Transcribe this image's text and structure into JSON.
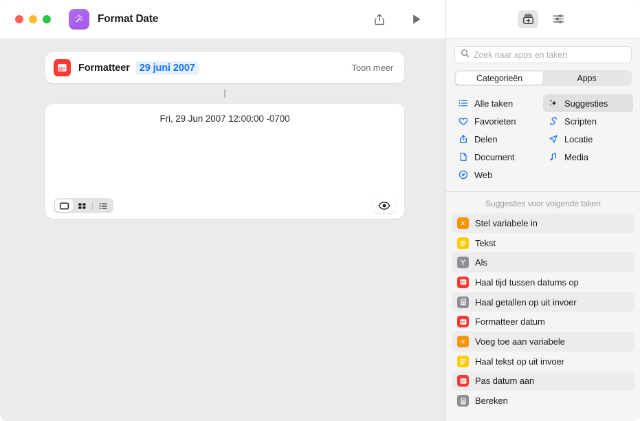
{
  "window": {
    "title": "Format Date",
    "app_icon": "magic-wand-icon",
    "traffic_lights": [
      "close",
      "minimize",
      "zoom"
    ],
    "toolbar": [
      {
        "name": "share-icon",
        "label": "Deel"
      },
      {
        "name": "play-icon",
        "label": "Voer uit"
      }
    ]
  },
  "editor": {
    "action": {
      "icon": "calendar-icon",
      "icon_color": "#fa3b33",
      "label": "Formatteer",
      "token": "29 juni 2007",
      "token_color": "#1573f5",
      "show_more": "Toon meer"
    },
    "result": {
      "text": "Fri, 29 Jun 2007 12:00:00 -0700"
    },
    "view_modes": [
      {
        "name": "single-view-icon",
        "active": true
      },
      {
        "name": "grid-view-icon",
        "active": false
      },
      {
        "name": "list-view-icon",
        "active": false
      }
    ],
    "preview_toggle": {
      "name": "eye-icon"
    }
  },
  "library": {
    "toolbar": [
      {
        "name": "action-library-icon",
        "selected": true
      },
      {
        "name": "sliders-icon",
        "selected": false
      }
    ],
    "search": {
      "placeholder": "Zoek naar apps en taken",
      "value": "",
      "icon": "search-icon"
    },
    "tabs": [
      {
        "label": "Categorieën",
        "active": true
      },
      {
        "label": "Apps",
        "active": false
      }
    ],
    "categories": [
      {
        "label": "Alle taken",
        "icon": "list-bullet-icon",
        "selected": false
      },
      {
        "label": "Suggesties",
        "icon": "sparkles-icon",
        "selected": true
      },
      {
        "label": "Favorieten",
        "icon": "heart-icon",
        "selected": false
      },
      {
        "label": "Scripten",
        "icon": "script-icon",
        "selected": false
      },
      {
        "label": "Delen",
        "icon": "share-icon",
        "selected": false
      },
      {
        "label": "Locatie",
        "icon": "location-icon",
        "selected": false
      },
      {
        "label": "Document",
        "icon": "document-icon",
        "selected": false
      },
      {
        "label": "Media",
        "icon": "music-note-icon",
        "selected": false
      },
      {
        "label": "Web",
        "icon": "compass-icon",
        "selected": false
      }
    ],
    "suggestions_header": "Suggesties voor volgende taken",
    "suggestions": [
      {
        "label": "Stel variabele in",
        "icon": "variable-icon",
        "color": "#f89406",
        "glyph": "x",
        "stripe": true
      },
      {
        "label": "Tekst",
        "icon": "text-icon",
        "color": "#ffcc00",
        "glyph": "≡",
        "stripe": false
      },
      {
        "label": "Als",
        "icon": "if-icon",
        "color": "#8e8e93",
        "glyph": "Y",
        "stripe": true
      },
      {
        "label": "Haal tijd tussen datums op",
        "icon": "calendar-icon",
        "color": "#fa3b33",
        "glyph": "▦",
        "stripe": false
      },
      {
        "label": "Haal getallen op uit invoer",
        "icon": "calculator-icon",
        "color": "#8e8e93",
        "glyph": "∷",
        "stripe": true
      },
      {
        "label": "Formatteer datum",
        "icon": "calendar-icon",
        "color": "#fa3b33",
        "glyph": "▦",
        "stripe": false
      },
      {
        "label": "Voeg toe aan variabele",
        "icon": "variable-icon",
        "color": "#f89406",
        "glyph": "x",
        "stripe": true
      },
      {
        "label": "Haal tekst op uit invoer",
        "icon": "text-icon",
        "color": "#ffcc00",
        "glyph": "≡",
        "stripe": false
      },
      {
        "label": "Pas datum aan",
        "icon": "calendar-icon",
        "color": "#fa3b33",
        "glyph": "▦",
        "stripe": true
      },
      {
        "label": "Bereken",
        "icon": "calculator-icon",
        "color": "#8e8e93",
        "glyph": "∷",
        "stripe": false
      }
    ]
  }
}
